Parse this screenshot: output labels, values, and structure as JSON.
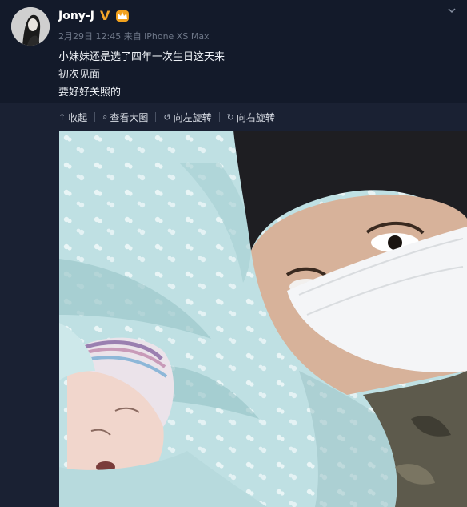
{
  "post": {
    "username": "Jony-J",
    "verified_badge": "V",
    "timestamp": "2月29日 12:45 来自 iPhone XS Max",
    "lines": [
      "小妹妹还是选了四年一次生日这天来",
      "初次见面",
      "要好好关照的"
    ]
  },
  "toolbar": {
    "collapse_label": "收起",
    "view_large_label": "查看大图",
    "rotate_left_label": "向左旋转",
    "rotate_right_label": "向右旋转"
  },
  "icons": {
    "collapse": "up-arrow-icon",
    "view_large": "magnifier-icon",
    "rotate_left": "rotate-left-icon",
    "rotate_right": "rotate-right-icon",
    "menu": "chevron-down-icon",
    "badge": "crown-badge-icon"
  },
  "colors": {
    "background": "#131a2a",
    "verified": "#f4a62a",
    "meta_text": "#6e7788"
  }
}
